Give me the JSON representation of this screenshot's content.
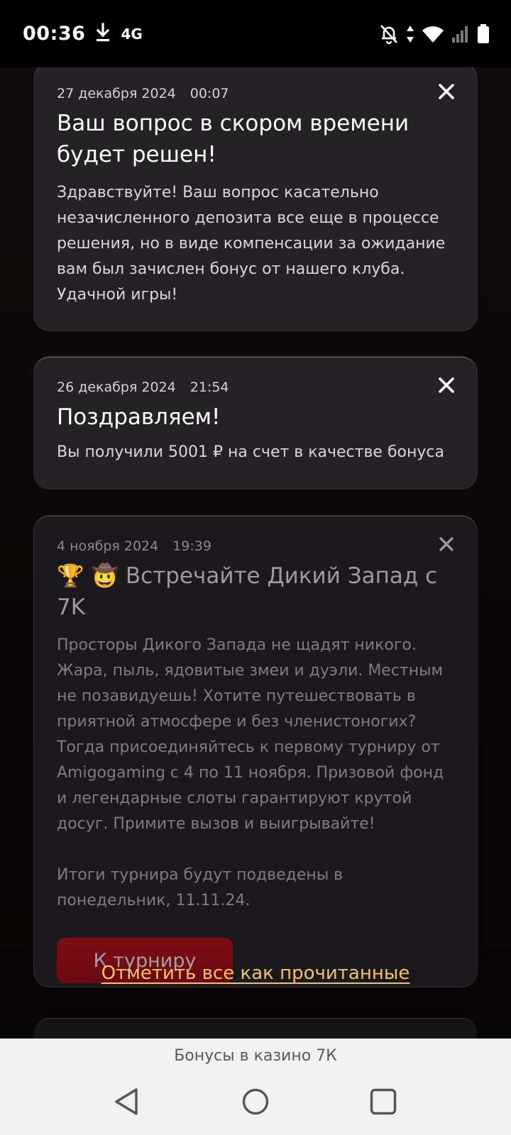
{
  "status_bar": {
    "time": "00:36",
    "network": "4G",
    "icons": [
      "download-icon",
      "mute-bell-icon",
      "data-arrows-icon",
      "wifi-icon",
      "signal-icon",
      "battery-icon"
    ]
  },
  "notifications": [
    {
      "date": "27 декабря 2024",
      "time": "00:07",
      "title": "Ваш вопрос в скором времени будет решен!",
      "body": "Здравствуйте! Ваш вопрос касательно незачисленного депозита все еще в процессе решения, но в виде компенсации за ожидание вам был зачислен бонус от нашего клуба. Удачной игры!"
    },
    {
      "date": "26 декабря 2024",
      "time": "21:54",
      "title": "Поздравляем!",
      "body": "Вы получили 5001 ₽ на счет в качестве бонуса"
    },
    {
      "date": "4 ноября 2024",
      "time": "19:39",
      "title": "🏆 🤠 Встречайте Дикий Запад с 7K",
      "body": "Просторы Дикого Запада не щадят никого. Жара, пыль, ядовитые змеи и дуэли. Местным не позавидуешь! Хотите путешествовать в приятной атмосфере и без членистоногих? Тогда присоединяйтесь к первому турниру от Amigogaming с 4 по 11 ноября. Призовой фонд и легендарные слоты гарантируют крутой досуг. Примите вызов и выигрывайте!\n\nИтоги турнира будут подведены в понедельник, 11.11.24.",
      "button": "К турниру"
    }
  ],
  "mark_all_read": "Отметить все как прочитанные",
  "bottom_bar": {
    "page_title": "Бонусы в казино 7К"
  },
  "colors": {
    "card_bg": "#242224",
    "accent_link": "#f2c36a",
    "button_bg": "#7e0d15"
  }
}
